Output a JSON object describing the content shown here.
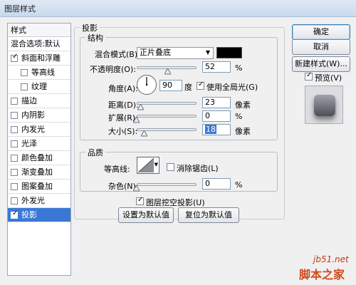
{
  "window": {
    "title": "图层样式"
  },
  "style_panel": {
    "header": "样式",
    "items": [
      {
        "label": "混合选项:默认",
        "checkbox": false
      },
      {
        "label": "斜面和浮雕",
        "checkbox": true,
        "checked": true
      },
      {
        "label": "等高线",
        "checkbox": true,
        "checked": false,
        "indent": true
      },
      {
        "label": "纹理",
        "checkbox": true,
        "checked": false,
        "indent": true
      },
      {
        "label": "描边",
        "checkbox": true,
        "checked": false
      },
      {
        "label": "内阴影",
        "checkbox": true,
        "checked": false
      },
      {
        "label": "内发光",
        "checkbox": true,
        "checked": false
      },
      {
        "label": "光泽",
        "checkbox": true,
        "checked": false
      },
      {
        "label": "颜色叠加",
        "checkbox": true,
        "checked": false
      },
      {
        "label": "渐变叠加",
        "checkbox": true,
        "checked": false
      },
      {
        "label": "图案叠加",
        "checkbox": true,
        "checked": false
      },
      {
        "label": "外发光",
        "checkbox": true,
        "checked": false
      },
      {
        "label": "投影",
        "checkbox": true,
        "checked": true,
        "selected": true
      }
    ]
  },
  "drop_shadow": {
    "section_title": "投影",
    "structure": {
      "title": "结构",
      "blend_mode_label": "混合模式(B):",
      "blend_mode_value": "正片叠底",
      "blend_color": "#000000",
      "opacity_label": "不透明度(O):",
      "opacity_value": "52",
      "opacity_unit": "%",
      "opacity_fraction": 0.52,
      "angle_label": "角度(A):",
      "angle_value": "90",
      "angle_unit": "度",
      "global_light_label": "使用全局光(G)",
      "global_light_checked": true,
      "distance_label": "距离(D):",
      "distance_value": "23",
      "distance_unit": "像素",
      "spread_label": "扩展(R):",
      "spread_value": "0",
      "spread_unit": "%",
      "size_label": "大小(S):",
      "size_value": "18",
      "size_unit": "像素"
    },
    "quality": {
      "title": "品质",
      "contour_label": "等高线:",
      "anti_alias_label": "消除锯齿(L)",
      "anti_alias_checked": false,
      "noise_label": "杂色(N):",
      "noise_value": "0",
      "noise_unit": "%"
    },
    "knockout_label": "图层挖空投影(U)",
    "knockout_checked": true,
    "make_default_label": "设置为默认值",
    "reset_default_label": "复位为默认值"
  },
  "buttons": {
    "ok": "确定",
    "cancel": "取消",
    "new_style": "新建样式(W)...",
    "preview_label": "预览(V)",
    "preview_checked": true
  },
  "watermark": {
    "site": "jb51.net",
    "brand": "脚本之家"
  },
  "colors": {
    "selection": "#3b78d6",
    "field_border": "#7f9db9",
    "window_bg": "#f0f0f0"
  }
}
